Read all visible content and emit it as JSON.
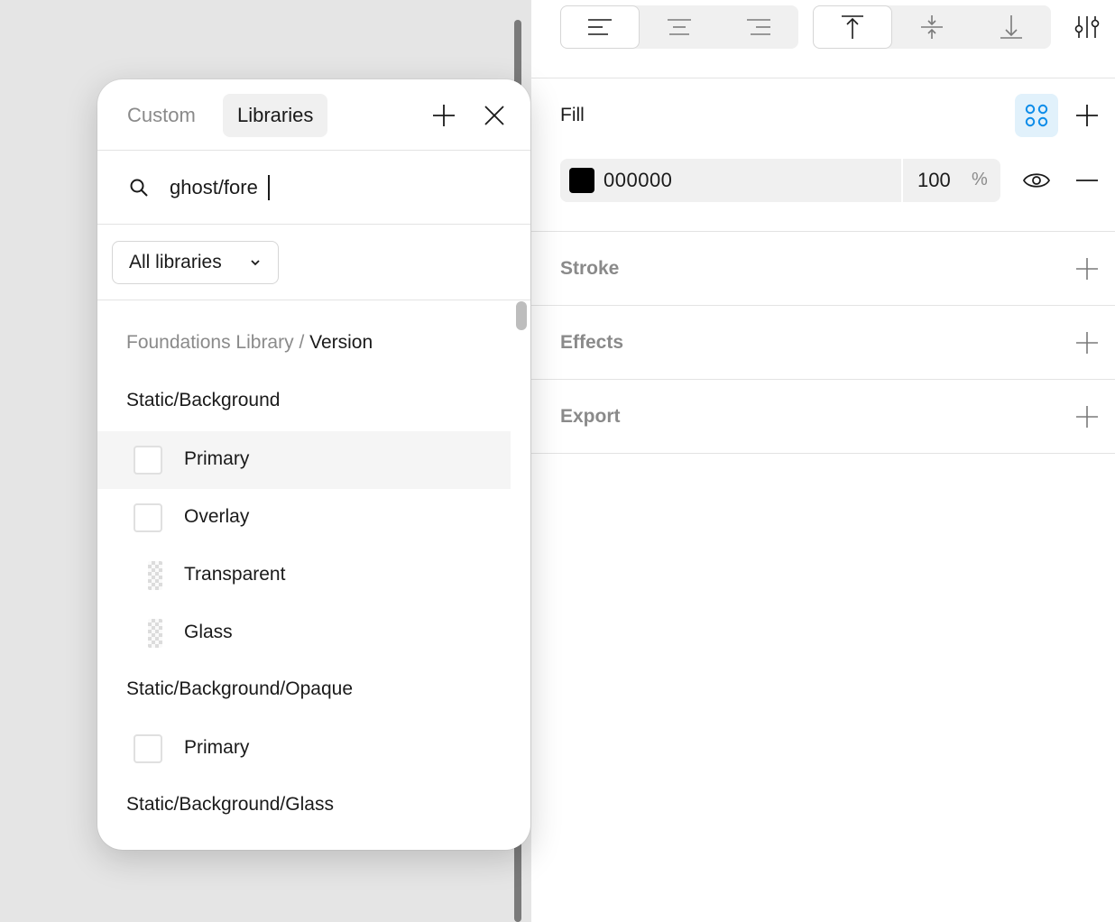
{
  "toolbar": {
    "text_align": [
      "align-left",
      "align-center",
      "align-right"
    ],
    "vertical_align": [
      "align-top",
      "align-middle",
      "align-bottom"
    ],
    "active_text_align": "align-left",
    "active_vertical_align": "align-top"
  },
  "fill": {
    "title": "Fill",
    "hex": "000000",
    "opacity": "100",
    "percent": "%",
    "swatch_color": "#000000"
  },
  "sections": {
    "stroke": "Stroke",
    "effects": "Effects",
    "export": "Export"
  },
  "popup": {
    "tabs": {
      "custom": "Custom",
      "libraries": "Libraries"
    },
    "active_tab": "Libraries",
    "search_value": "ghost/fore",
    "library_filter": "All libraries",
    "breadcrumb": {
      "library": "Foundations Library / ",
      "current": "Version"
    },
    "groups": [
      {
        "name": "Static/Background",
        "items": [
          "Primary",
          "Overlay",
          "Transparent",
          "Glass"
        ]
      },
      {
        "name": "Static/Background/Opaque",
        "items": [
          "Primary"
        ]
      },
      {
        "name": "Static/Background/Glass",
        "items": []
      }
    ]
  },
  "colors": {
    "accent": "#0c8ce9",
    "accent_bg": "#e1f1fb",
    "canvas": "#e5e5e5"
  }
}
